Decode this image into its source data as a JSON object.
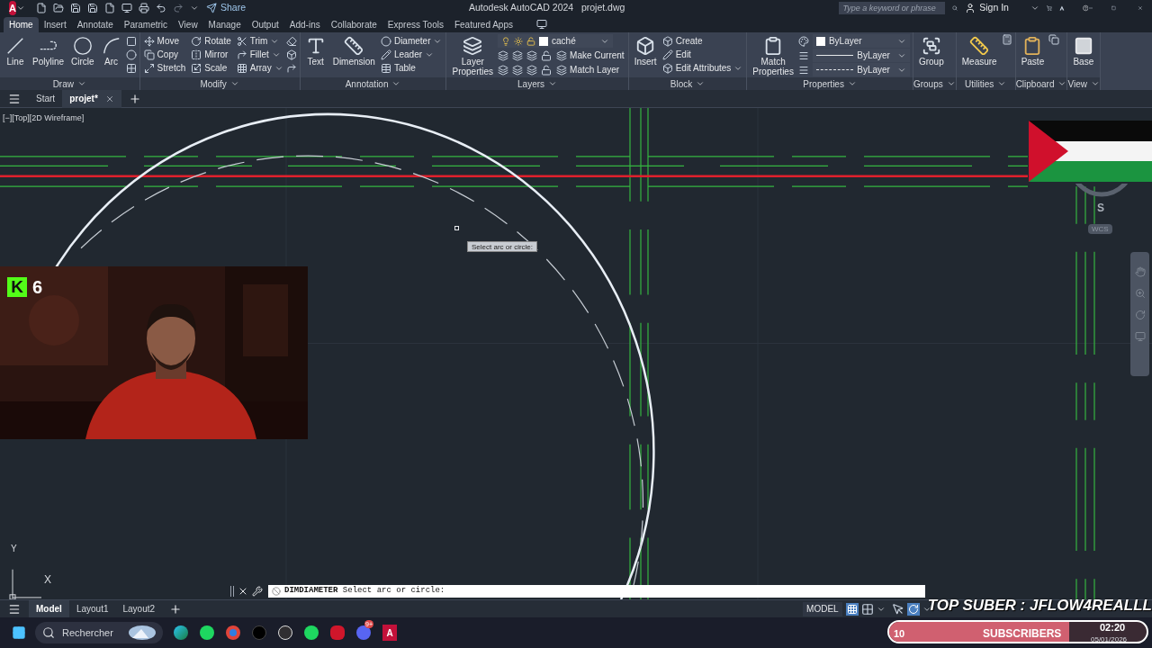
{
  "title_bar": {
    "app_letter": "A",
    "share": "Share",
    "app_title": "Autodesk AutoCAD 2024",
    "file": "projet.dwg",
    "search_placeholder": "Type a keyword or phrase",
    "sign_in": "Sign In"
  },
  "ribbon_tabs": [
    {
      "label": "Home",
      "selected": true
    },
    {
      "label": "Insert",
      "selected": false
    },
    {
      "label": "Annotate",
      "selected": false
    },
    {
      "label": "Parametric",
      "selected": false
    },
    {
      "label": "View",
      "selected": false
    },
    {
      "label": "Manage",
      "selected": false
    },
    {
      "label": "Output",
      "selected": false
    },
    {
      "label": "Add-ins",
      "selected": false
    },
    {
      "label": "Collaborate",
      "selected": false
    },
    {
      "label": "Express Tools",
      "selected": false
    },
    {
      "label": "Featured Apps",
      "selected": false
    }
  ],
  "draw": {
    "title": "Draw",
    "large": [
      "Line",
      "Polyline",
      "Circle",
      "Arc"
    ]
  },
  "modify": {
    "title": "Modify",
    "tools": [
      {
        "label": "Move",
        "menu": false
      },
      {
        "label": "Rotate",
        "menu": false
      },
      {
        "label": "Trim",
        "menu": true
      },
      {
        "label": "Copy",
        "menu": false
      },
      {
        "label": "Mirror",
        "menu": false
      },
      {
        "label": "Fillet",
        "menu": true
      },
      {
        "label": "Stretch",
        "menu": false
      },
      {
        "label": "Scale",
        "menu": false
      },
      {
        "label": "Array",
        "menu": true
      }
    ]
  },
  "annotation": {
    "title": "Annotation",
    "large": [
      "Text",
      "Dimension"
    ],
    "small": [
      {
        "label": "Diameter",
        "menu": true
      },
      {
        "label": "Leader",
        "menu": true
      },
      {
        "label": "Table",
        "menu": false
      }
    ]
  },
  "layers": {
    "title": "Layers",
    "large": "Layer Properties",
    "current_layer": "caché",
    "small": [
      "Make Current",
      "Match Layer"
    ]
  },
  "block": {
    "title": "Block",
    "large": "Insert",
    "small": [
      {
        "label": "Create",
        "menu": false
      },
      {
        "label": "Edit",
        "menu": false
      },
      {
        "label": "Edit Attributes",
        "menu": true
      }
    ]
  },
  "properties": {
    "title": "Properties",
    "large": "Match Properties",
    "color_setting": "ByLayer",
    "lineweight": "ByLayer",
    "linetype": "ByLayer"
  },
  "groups": {
    "title": "Groups",
    "large": "Group"
  },
  "utilities": {
    "title": "Utilities",
    "large": "Measure"
  },
  "clipboard": {
    "title": "Clipboard",
    "large": "Paste"
  },
  "view": {
    "title": "View",
    "large": "Base"
  },
  "file_tabs": [
    {
      "label": "Start",
      "selected": false,
      "closable": false
    },
    {
      "label": "projet*",
      "selected": true,
      "closable": true
    }
  ],
  "viewport_label": "[−][Top][2D Wireframe]",
  "tooltip": "Select arc or circle:",
  "compass": {
    "direction": "S",
    "ucs": "WCS"
  },
  "ucs_icon": {
    "y_label": "Y",
    "x_label": "X"
  },
  "command_line": {
    "command": "DIMDIAMETER",
    "prompt": "Select arc or circle:"
  },
  "layout_tabs": [
    {
      "label": "Model",
      "selected": true
    },
    {
      "label": "Layout1",
      "selected": false
    },
    {
      "label": "Layout2",
      "selected": false
    }
  ],
  "status_bar": {
    "space": "MODEL"
  },
  "overlays": {
    "logo_letter": "K",
    "viewers": "6",
    "top_suber": "TOP SUBER : JFLOW4REALLL",
    "subscribers": {
      "count": "10",
      "label": "SUBSCRIBERS",
      "level": 0.7
    }
  },
  "taskbar": {
    "search": "Rechercher",
    "autocad_letter": "A",
    "discord_badge": "9+",
    "time": "02:20",
    "date": "05/01/2026"
  }
}
